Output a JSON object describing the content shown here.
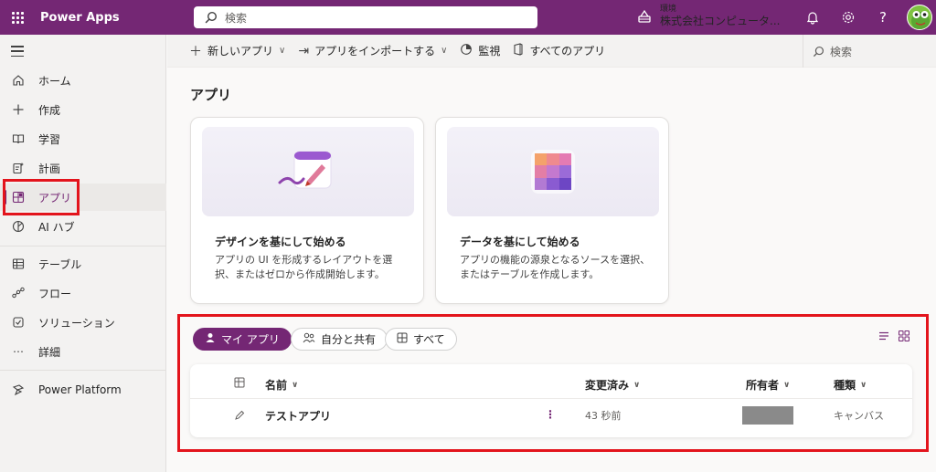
{
  "topbar": {
    "app_name": "Power Apps",
    "search_placeholder": "検索",
    "env_label": "環境",
    "env_value": "株式会社コンピュータ..."
  },
  "sidebar": {
    "items": [
      {
        "label": "ホーム",
        "icon": "home-icon"
      },
      {
        "label": "作成",
        "icon": "plus-icon"
      },
      {
        "label": "学習",
        "icon": "book-icon"
      },
      {
        "label": "計画",
        "icon": "plan-icon"
      },
      {
        "label": "アプリ",
        "icon": "apps-icon",
        "active": true
      },
      {
        "label": "AI ハブ",
        "icon": "ai-hub-icon"
      },
      {
        "label": "テーブル",
        "icon": "table-icon"
      },
      {
        "label": "フロー",
        "icon": "flow-icon"
      },
      {
        "label": "ソリューション",
        "icon": "solution-icon"
      },
      {
        "label": "詳細",
        "icon": "more-icon"
      },
      {
        "label": "Power Platform",
        "icon": "power-platform-icon"
      }
    ]
  },
  "cmdbar": {
    "new_app": "新しいアプリ",
    "import_app": "アプリをインポートする",
    "monitor": "監視",
    "all_apps": "すべてのアプリ",
    "search": "検索"
  },
  "page_title": "アプリ",
  "cards": [
    {
      "title": "デザインを基にして始める",
      "desc": "アプリの UI を形成するレイアウトを選択、またはゼロから作成開始します。"
    },
    {
      "title": "データを基にして始める",
      "desc": "アプリの機能の源泉となるソースを選択、またはテーブルを作成します。"
    }
  ],
  "filters": {
    "my_apps": "マイ アプリ",
    "shared": "自分と共有",
    "all": "すべて"
  },
  "table": {
    "headers": {
      "name": "名前",
      "modified": "変更済み",
      "owner": "所有者",
      "type": "種類"
    },
    "rows": [
      {
        "name": "テストアプリ",
        "modified": "43 秒前",
        "type": "キャンバス"
      }
    ]
  },
  "colors": {
    "brand": "#742774",
    "highlight": "#e3141c"
  }
}
